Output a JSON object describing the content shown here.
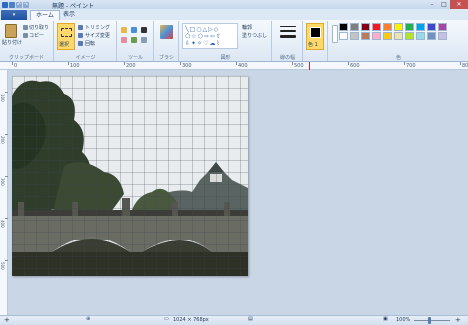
{
  "window": {
    "title": "無題 - ペイント",
    "controls": [
      "–",
      "□",
      "✕"
    ]
  },
  "tabs": {
    "file": "▾",
    "home": "ホーム",
    "view": "表示"
  },
  "ribbon": {
    "clipboard": {
      "paste": "貼り付け",
      "cut": "切り取り",
      "copy": "コピー",
      "label": "クリップボード"
    },
    "image": {
      "select": "選択",
      "crop": "トリミング",
      "resize": "サイズ変更",
      "rotate": "回転",
      "label": "イメージ"
    },
    "tools": {
      "label": "ツール"
    },
    "brushes": {
      "label": "ブラシ"
    },
    "shapes": {
      "outline": "輪郭",
      "fill": "塗りつぶし",
      "label": "図形"
    },
    "size": {
      "label": "線の幅"
    },
    "color1": {
      "label": "色 1"
    },
    "colors": {
      "label": "色"
    }
  },
  "ruler": {
    "ticks": [
      "0",
      "100",
      "200",
      "300",
      "400",
      "500",
      "600",
      "700",
      "800"
    ]
  },
  "vruler": {
    "ticks": [
      "100",
      "200",
      "300",
      "400",
      "500"
    ]
  },
  "status": {
    "position": "",
    "selection": "",
    "size": "1024 × 768px",
    "filesize": "",
    "zoom": "100%"
  },
  "colors": {
    "palette": [
      "#000000",
      "#7f7f7f",
      "#880015",
      "#ed1c24",
      "#ff7f27",
      "#fff200",
      "#22b14c",
      "#00a2e8",
      "#3f48cc",
      "#a349a4",
      "#ffffff",
      "#c3c3c3",
      "#b97a57",
      "#ffaec9",
      "#ffc90e",
      "#efe4b0",
      "#b5e61d",
      "#99d9ea",
      "#7092be",
      "#c8bfe7"
    ],
    "color1": "#000000"
  }
}
